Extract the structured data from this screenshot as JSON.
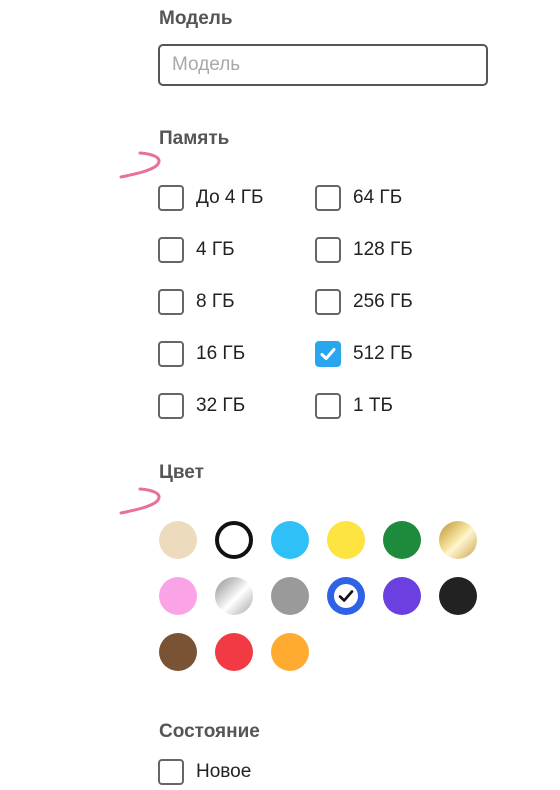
{
  "model": {
    "title": "Модель",
    "placeholder": "Модель",
    "value": ""
  },
  "memory": {
    "title": "Память",
    "options": [
      {
        "label": "До 4 ГБ",
        "checked": false
      },
      {
        "label": "4 ГБ",
        "checked": false
      },
      {
        "label": "8 ГБ",
        "checked": false
      },
      {
        "label": "16 ГБ",
        "checked": false
      },
      {
        "label": "32 ГБ",
        "checked": false
      },
      {
        "label": "64 ГБ",
        "checked": false
      },
      {
        "label": "128 ГБ",
        "checked": false
      },
      {
        "label": "256 ГБ",
        "checked": false
      },
      {
        "label": "512 ГБ",
        "checked": true
      },
      {
        "label": "1 ТБ",
        "checked": false
      }
    ]
  },
  "color": {
    "title": "Цвет",
    "swatches": [
      {
        "name": "beige",
        "color": "#ecdcbd",
        "selected": false
      },
      {
        "name": "white",
        "color": "#ffffff",
        "selected": false
      },
      {
        "name": "light-blue",
        "color": "#2ec0f7",
        "selected": false
      },
      {
        "name": "yellow",
        "color": "#fde441",
        "selected": false
      },
      {
        "name": "green",
        "color": "#1e8a3c",
        "selected": false
      },
      {
        "name": "gold",
        "color": "gradient-gold",
        "selected": false
      },
      {
        "name": "pink",
        "color": "#fba3e7",
        "selected": false
      },
      {
        "name": "silver",
        "color": "gradient-silver",
        "selected": false
      },
      {
        "name": "gray",
        "color": "#9a9a9a",
        "selected": false
      },
      {
        "name": "blue",
        "color": "#2f63e6",
        "selected": true
      },
      {
        "name": "purple",
        "color": "#6b3fe0",
        "selected": false
      },
      {
        "name": "black",
        "color": "#222222",
        "selected": false
      },
      {
        "name": "brown",
        "color": "#7a5234",
        "selected": false
      },
      {
        "name": "red",
        "color": "#f23a44",
        "selected": false
      },
      {
        "name": "orange",
        "color": "#ffaa31",
        "selected": false
      }
    ]
  },
  "condition": {
    "title": "Состояние",
    "options": [
      {
        "label": "Новое",
        "checked": false
      }
    ]
  },
  "annotation_color": "#e8709a"
}
